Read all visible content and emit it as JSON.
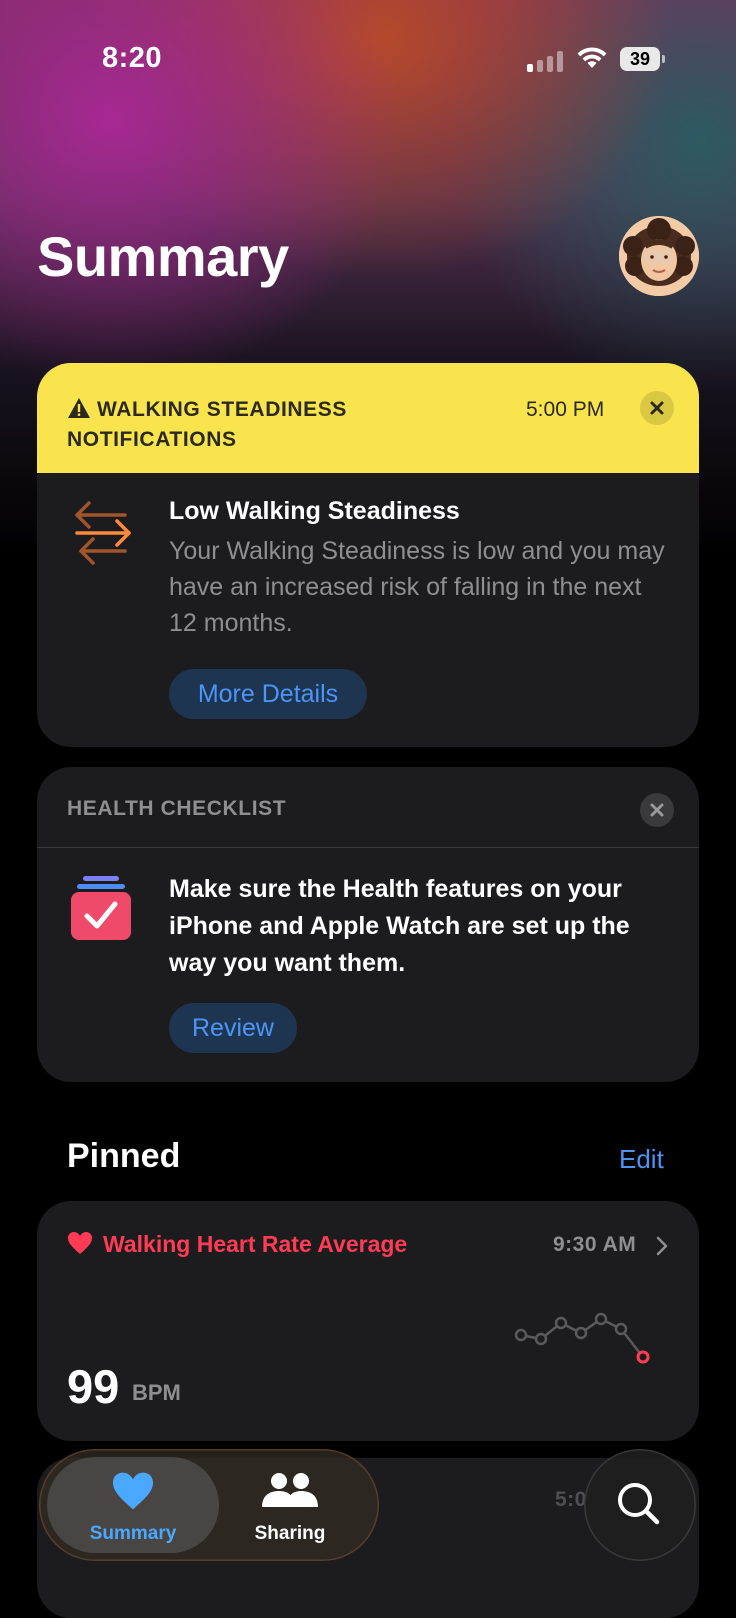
{
  "status_bar": {
    "time": "8:20",
    "battery": "39"
  },
  "header": {
    "title": "Summary"
  },
  "walking_card": {
    "header_title": "WALKING STEADINESS NOTIFICATIONS",
    "time": "5:00 PM",
    "title": "Low Walking Steadiness",
    "body": "Your Walking Steadiness is low and you may have an increased risk of falling in the next 12 months.",
    "button_label": "More Details",
    "accent_color": "#f9e44d"
  },
  "checklist_card": {
    "label": "HEALTH CHECKLIST",
    "body": "Make sure the Health features on your iPhone and Apple Watch are set up the way you want them.",
    "button_label": "Review"
  },
  "pinned": {
    "title": "Pinned",
    "edit_label": "Edit",
    "heart_rate": {
      "name": "Walking Heart Rate Average",
      "time": "9:30 AM",
      "value": "99",
      "unit": "BPM",
      "color": "#ff3b55"
    },
    "next_card_time": "5:0"
  },
  "tab_bar": {
    "tabs": [
      {
        "label": "Summary",
        "icon": "heart-icon",
        "active": true
      },
      {
        "label": "Sharing",
        "icon": "people-icon",
        "active": false
      }
    ],
    "search_icon": "search-icon"
  }
}
